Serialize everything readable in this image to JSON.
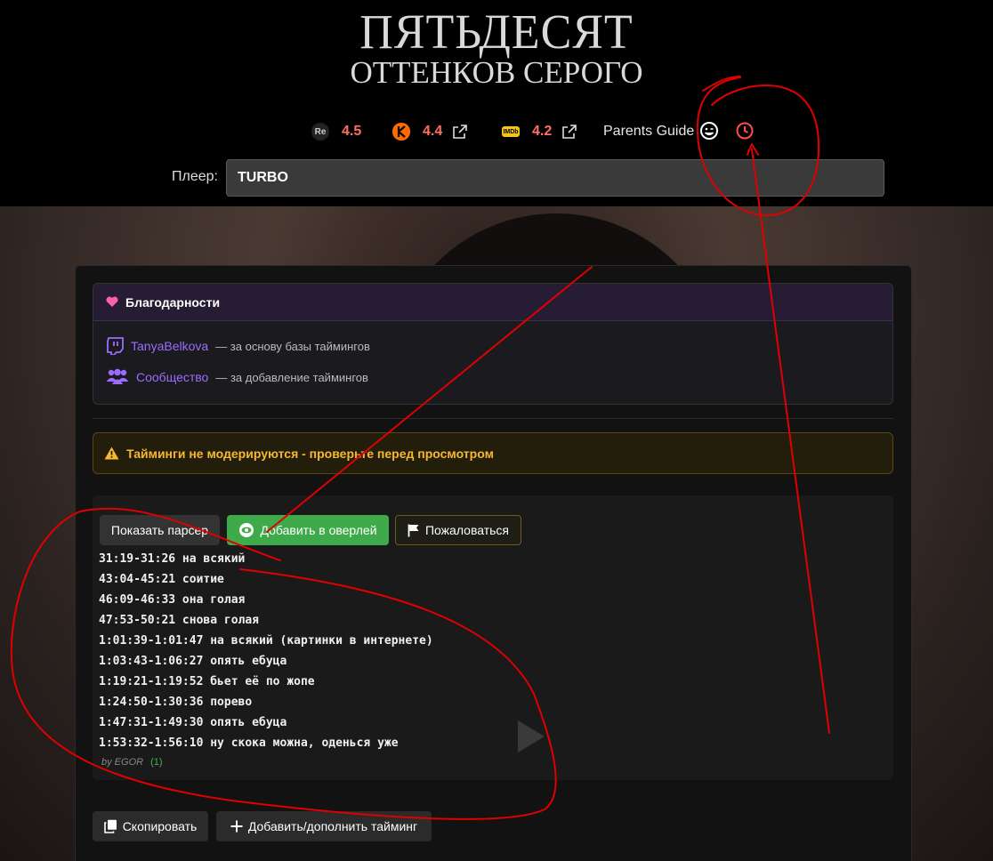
{
  "title": {
    "line1": "ПЯТЬДЕСЯТ",
    "line2": "ОТТЕНКОВ СЕРОГО"
  },
  "ratings": [
    {
      "source": "re-icon",
      "value": "4.5"
    },
    {
      "source": "kinopoisk-icon",
      "value": "4.4"
    },
    {
      "source": "imdb-icon",
      "value": "4.2"
    }
  ],
  "parents_guide": "Parents Guide",
  "player": {
    "label": "Плеер:",
    "value": "TURBO"
  },
  "thanks": {
    "title": "Благодарности",
    "rows": [
      {
        "name": "TanyaBelkova",
        "desc": "— за основу базы таймингов"
      },
      {
        "name": "Сообщество",
        "desc": "— за добавление таймингов"
      }
    ]
  },
  "warning": "Тайминги не модерируются - проверьте перед просмотром",
  "buttons": {
    "parser": "Показать парсер",
    "overlay": "Добавить в оверлей",
    "complain": "Пожаловаться",
    "copy": "Скопировать",
    "add": "Добавить/дополнить тайминг"
  },
  "timings": [
    "31:19-31:26 на всякий",
    "43:04-45:21 соитие",
    "46:09-46:33 она голая",
    "47:53-50:21 снова голая",
    "1:01:39-1:01:47 на всякий (картинки в интернете)",
    "1:03:43-1:06:27 опять ебуца",
    "1:19:21-1:19:52 бьет её по жопе",
    "1:24:50-1:30:36 порево",
    "1:47:31-1:49:30 опять ебуца",
    "1:53:32-1:56:10 ну скока можна, оденься уже"
  ],
  "byline": {
    "author": "by EGOR",
    "count": "(1)"
  },
  "colors": {
    "rating": "#ff6f61",
    "accent_green": "#3faa4a",
    "warning": "#f5b82e",
    "link_purple": "#9b6cff",
    "annotation_red": "#e00000"
  }
}
